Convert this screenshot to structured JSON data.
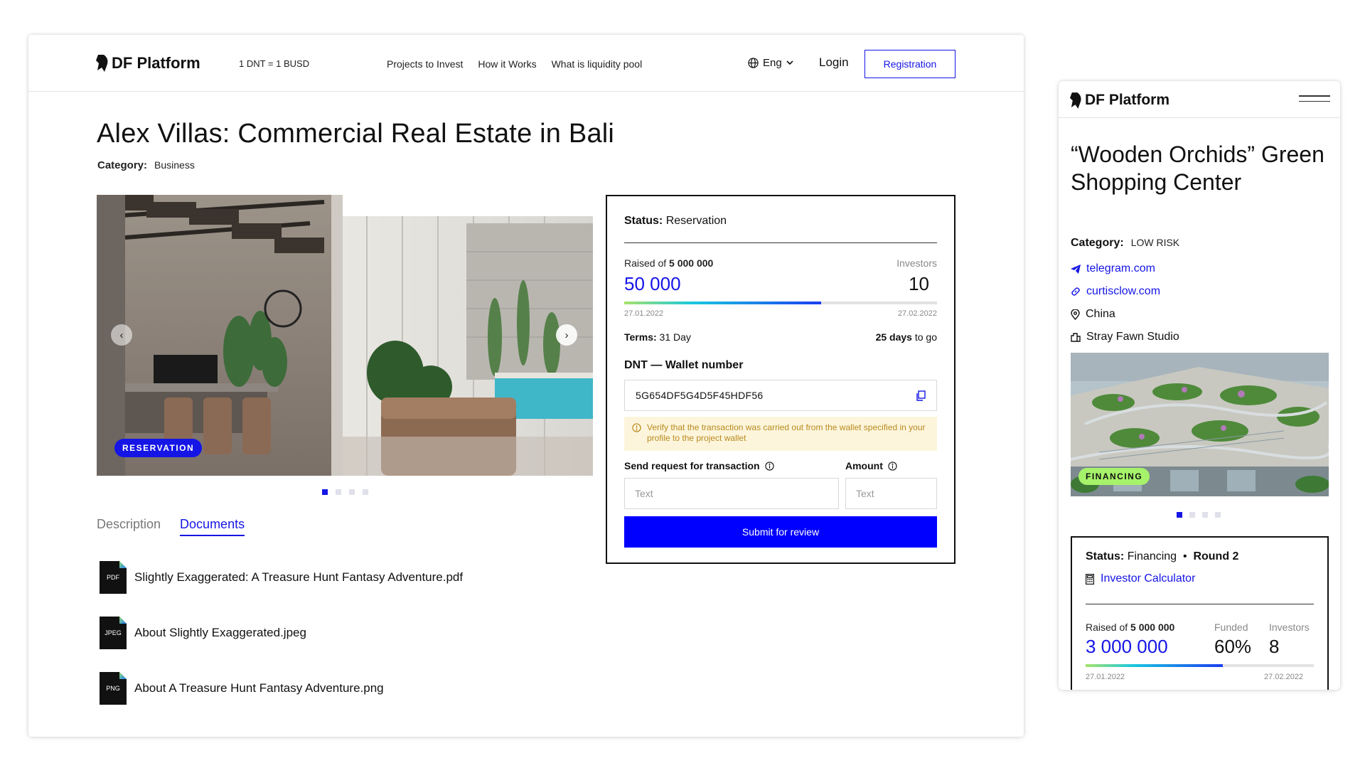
{
  "desktop": {
    "nav": {
      "logo": "DF Platform",
      "rate": "1 DNT = 1 BUSD",
      "links": [
        "Projects to Invest",
        "How it Works",
        "What is liquidity pool"
      ],
      "language": "Eng",
      "login": "Login",
      "registration": "Registration"
    },
    "project": {
      "title": "Alex Villas: Commercial Real Estate in Bali",
      "category_label": "Category:",
      "category_value": "Business",
      "badge": "RESERVATION",
      "slide_count": 4,
      "active_slide": 1
    },
    "tabs": {
      "description": "Description",
      "documents": "Documents",
      "active": "documents"
    },
    "documents": [
      {
        "type": "PDF",
        "name": "Slightly Exaggerated: A Treasure Hunt Fantasy Adventure.pdf"
      },
      {
        "type": "JPEG",
        "name": "About Slightly Exaggerated.jpeg"
      },
      {
        "type": "PNG",
        "name": "About A Treasure Hunt Fantasy Adventure.png"
      }
    ],
    "status_panel": {
      "status_label": "Status:",
      "status_value": "Reservation",
      "raised_of": "Raised of",
      "raised_target": "5 000 000",
      "raised_amount": "50 000",
      "investors_label": "Investors",
      "investors_value": "10",
      "progress_fraction": 0.63,
      "start_date": "27.01.2022",
      "end_date": "27.02.2022",
      "terms_label": "Terms:",
      "terms_value": "31 Day",
      "days_left": "25 days",
      "days_left_suffix": "to go",
      "wallet_label": "DNT — Wallet number",
      "wallet_number": "5G654DF5G4D5F45HDF56",
      "warning": "Verify that the transaction was carried out from the wallet specified in your profile to the project wallet",
      "send_label": "Send request for transaction",
      "amount_label": "Amount",
      "send_placeholder": "Text",
      "amount_placeholder": "Text",
      "submit": "Submit for review"
    }
  },
  "mobile": {
    "logo": "DF Platform",
    "title": "“Wooden Orchids” Green Shopping Center",
    "category_label": "Category:",
    "category_value": "LOW RISK",
    "links": [
      {
        "icon": "telegram-icon",
        "text": "telegram.com"
      },
      {
        "icon": "link-icon",
        "text": "curtisclow.com"
      },
      {
        "icon": "location-pin-icon",
        "text": "China"
      },
      {
        "icon": "company-icon",
        "text": "Stray Fawn Studio"
      }
    ],
    "badge": "FINANCING",
    "status_label": "Status:",
    "status_value": "Financing",
    "round": "Round 2",
    "calculator": "Investor Calculator",
    "raised_of": "Raised of",
    "raised_target": "5 000 000",
    "funded_label": "Funded",
    "investors_label": "Investors",
    "raised_amount": "3 000 000",
    "funded_value": "60%",
    "investors_value": "8",
    "progress_fraction": 0.6,
    "start_date": "27.01.2022",
    "end_date": "27.02.2022"
  },
  "colors": {
    "accent": "#1515e6",
    "submit": "#0000ff",
    "financing_badge": "#a6f26a",
    "warning_bg": "#fcf5dc",
    "warning_text": "#b98a1d"
  }
}
